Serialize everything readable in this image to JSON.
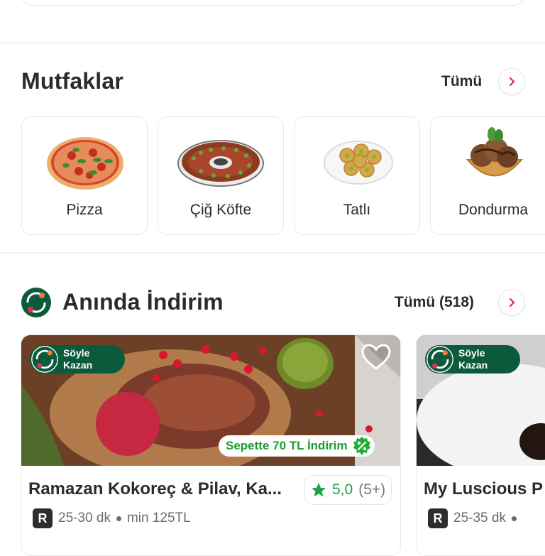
{
  "cuisines": {
    "title": "Mutfaklar",
    "see_all": "Tümü",
    "items": [
      {
        "label": "Pizza"
      },
      {
        "label": "Çiğ Köfte"
      },
      {
        "label": "Tatlı"
      },
      {
        "label": "Dondurma"
      }
    ]
  },
  "instant_discount": {
    "title": "Anında İndirim",
    "see_all": "Tümü (518)",
    "restaurants": [
      {
        "badge_line1": "Söyle",
        "badge_line2": "Kazan",
        "discount": "Sepette 70 TL İndirim",
        "name": "Ramazan Kokoreç & Pilav, Ka...",
        "rating": "5,0",
        "rating_count": "(5+)",
        "delivery_badge": "R",
        "delivery_time": "25-30 dk",
        "min_order": "min 125TL"
      },
      {
        "badge_line1": "Söyle",
        "badge_line2": "Kazan",
        "name": "My Luscious P",
        "delivery_badge": "R",
        "delivery_time": "25-35 dk"
      }
    ]
  },
  "colors": {
    "accent_pink": "#e0245e",
    "brand_green": "#0b5a3c",
    "discount_green": "#1a9d2f",
    "rating_star": "#1aa34a"
  }
}
